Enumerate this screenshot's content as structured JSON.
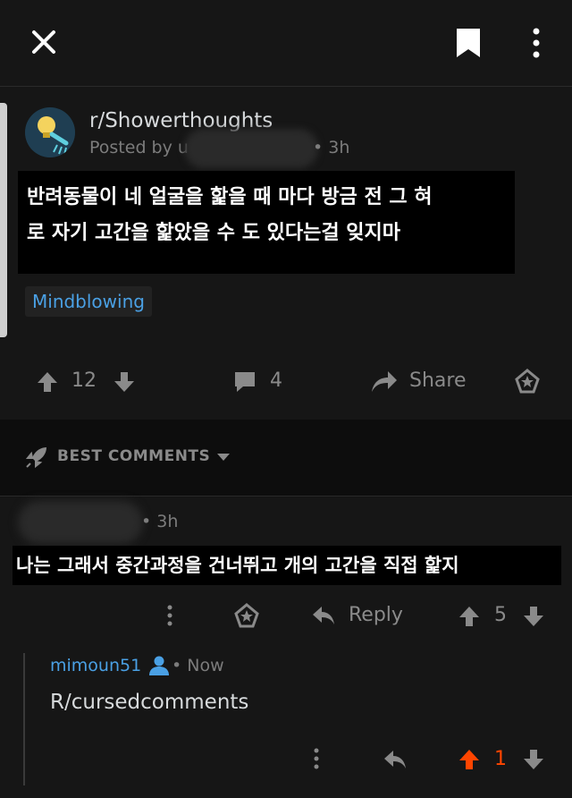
{
  "header": {
    "close_icon": "close-icon",
    "bookmark_icon": "bookmark-icon",
    "more_icon": "more-vertical-icon"
  },
  "post": {
    "subreddit": "r/Showerthoughts",
    "posted_by": "Posted by u",
    "time": "• 3h",
    "title_line1": "반려동물이 네 얼굴을 핥을 때 마다 방금 전 그 혀",
    "title_line2": "로 자기 고간을 핥았을 수 도 있다는걸 잊지마",
    "flair": "Mindblowing",
    "upvotes": "12",
    "comments": "4",
    "share_label": "Share"
  },
  "comments_header": {
    "label": "BEST COMMENTS"
  },
  "comment": {
    "time": "• 3h",
    "body": "나는 그래서 중간과정을 건너뛰고 개의 고간을 직접 핥지",
    "reply_label": "Reply",
    "votes": "5"
  },
  "reply": {
    "username": "mimoun51",
    "time": "• Now",
    "body": "R/cursedcomments",
    "votes": "1"
  },
  "colors": {
    "accent_blue": "#4aa0e4",
    "upvote_orange": "#ff4500"
  }
}
